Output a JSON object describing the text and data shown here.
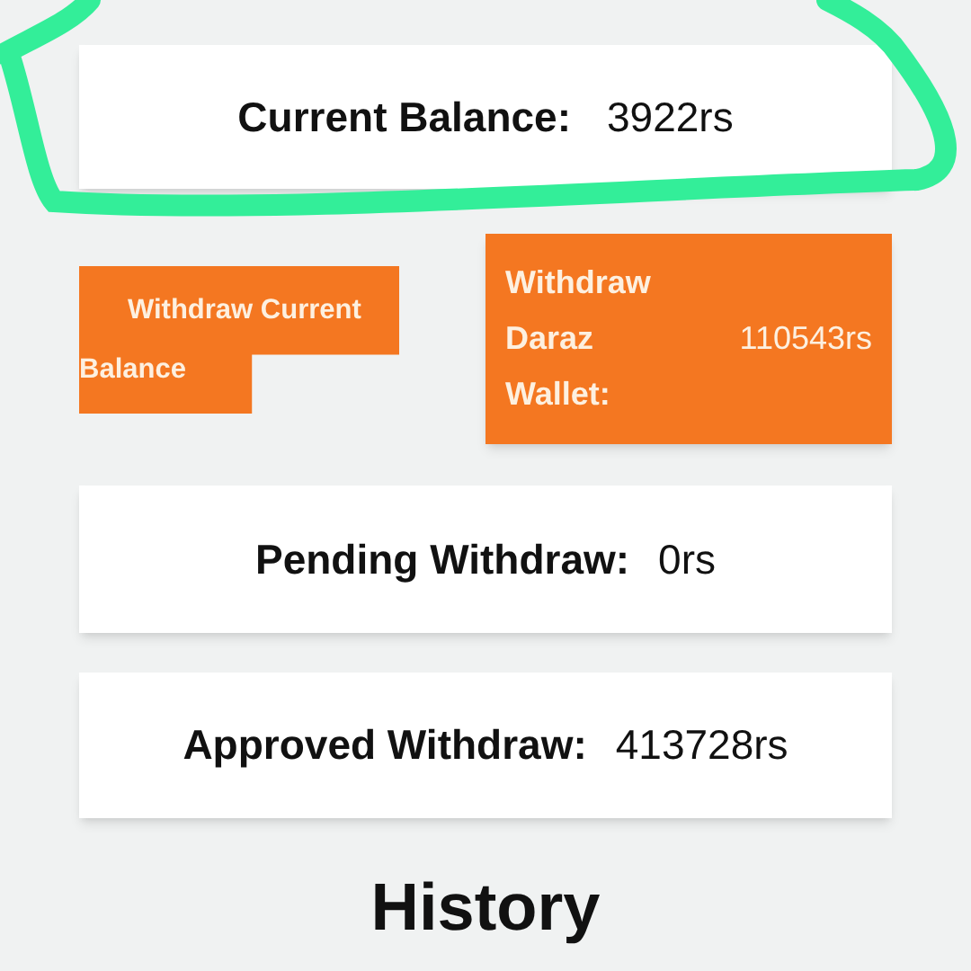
{
  "balance_card": {
    "label": "Current Balance:",
    "value": "3922rs"
  },
  "withdraw_current_button": {
    "label": "Withdraw Current Balance"
  },
  "daraz_wallet_card": {
    "label": "Withdraw Daraz Wallet:",
    "value": "110543rs"
  },
  "pending_card": {
    "label": "Pending Withdraw:",
    "value": "0rs"
  },
  "approved_card": {
    "label": "Approved Withdraw:",
    "value": "413728rs"
  },
  "history_heading": "History"
}
